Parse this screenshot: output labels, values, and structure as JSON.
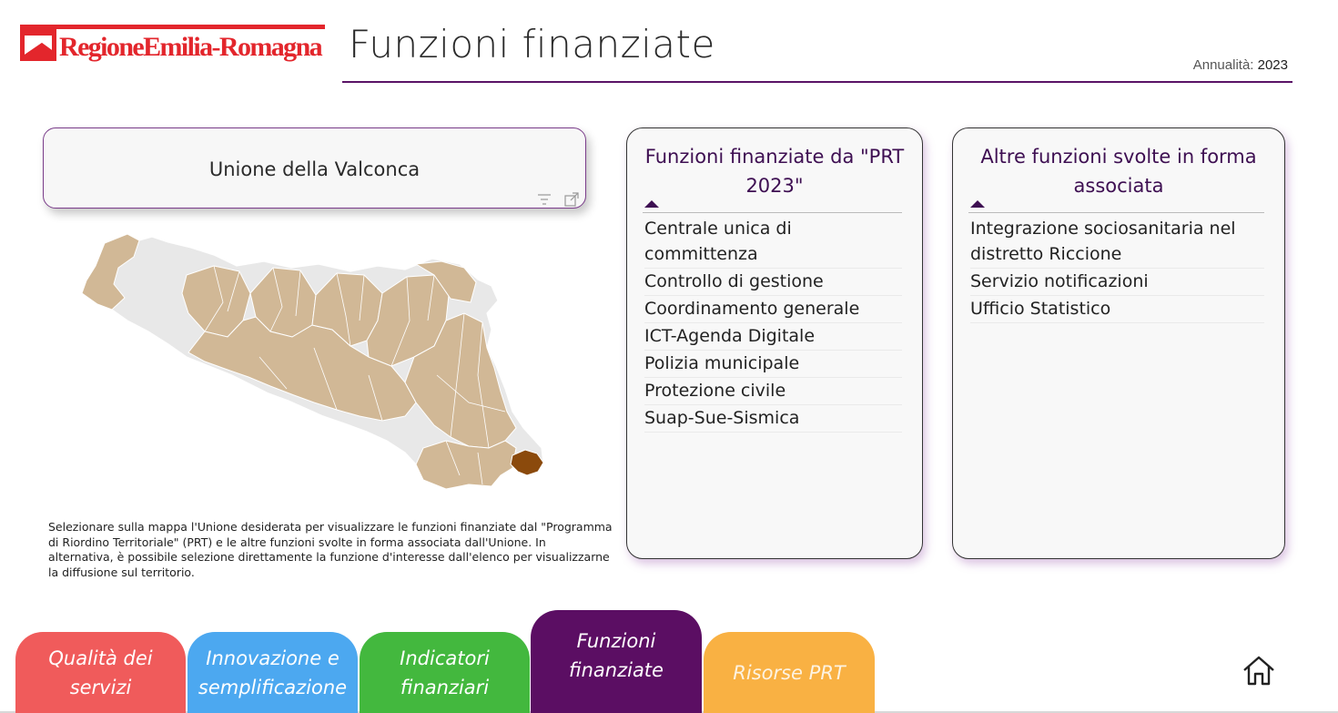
{
  "header": {
    "logo_text": "RegioneEmilia-Romagna",
    "title": "Funzioni finanziate",
    "year_label": "Annualità: ",
    "year_value": "2023"
  },
  "union": {
    "name": "Unione della Valconca",
    "icons": [
      "filter-icon",
      "expand-icon"
    ]
  },
  "map": {
    "colors": {
      "selected_union": "#8b4a0c",
      "other_unions": "#d1b896",
      "no_union": "#e8e8e8",
      "borders": "#ffffff"
    }
  },
  "description": "Selezionare sulla mappa l'Unione desiderata per visualizzare le funzioni finanziate dal \"Programma di Riordino Territoriale\" (PRT) e le altre funzioni svolte in forma associata dall'Unione. In alternativa, è possibile selezione direttamente la funzione d'interesse dall'elenco per visualizzarne la diffusione sul territorio.",
  "panel_prt": {
    "title": "Funzioni finanziate da \"PRT 2023\"",
    "items": [
      "Centrale unica di committenza",
      "Controllo di gestione",
      "Coordinamento generale",
      "ICT-Agenda Digitale",
      "Polizia municipale",
      "Protezione civile",
      "Suap-Sue-Sismica"
    ]
  },
  "panel_other": {
    "title": "Altre funzioni svolte in forma associata",
    "items": [
      "Integrazione sociosanitaria nel distretto Riccione",
      "Servizio notificazioni",
      "Ufficio Statistico"
    ]
  },
  "tabs": [
    {
      "label": "Qualità dei servizi",
      "color": "#f05b5b"
    },
    {
      "label": "Innovazione e semplificazione",
      "color": "#4ca8f0"
    },
    {
      "label": "Indicatori finanziari",
      "color": "#43b83e"
    },
    {
      "label": "Funzioni finanziate",
      "color": "#5b0e63",
      "active": true
    },
    {
      "label": "Risorse PRT",
      "color": "#f9b143"
    }
  ],
  "home_icon": "home-icon"
}
